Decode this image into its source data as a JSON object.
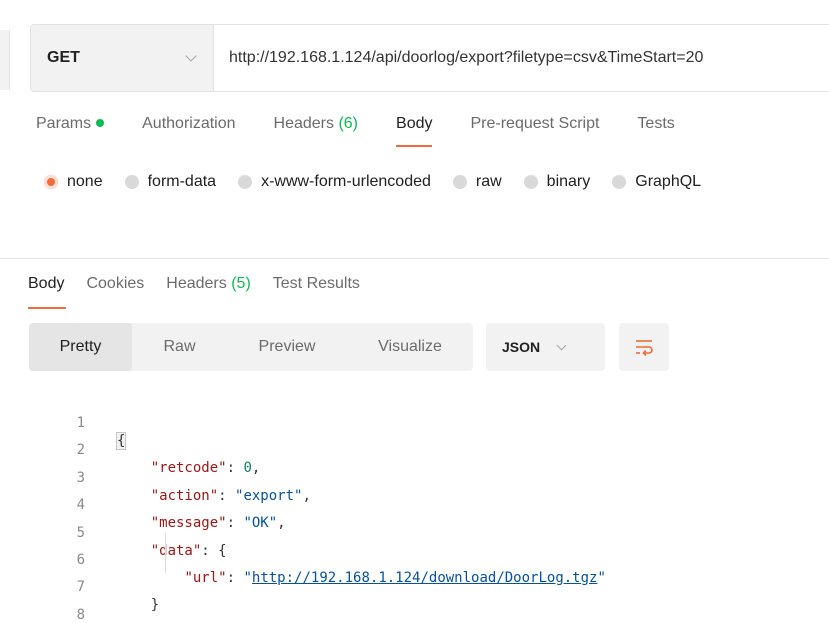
{
  "request": {
    "method": "GET",
    "url": "http://192.168.1.124/api/doorlog/export?filetype=csv&TimeStart=20"
  },
  "request_tabs": {
    "params": "Params",
    "authorization": "Authorization",
    "headers_label": "Headers",
    "headers_count": "(6)",
    "body": "Body",
    "pre_request": "Pre-request Script",
    "tests": "Tests"
  },
  "body_types": {
    "none": "none",
    "form_data": "form-data",
    "urlencoded": "x-www-form-urlencoded",
    "raw": "raw",
    "binary": "binary",
    "graphql": "GraphQL",
    "selected": "none"
  },
  "response_tabs": {
    "body": "Body",
    "cookies": "Cookies",
    "headers_label": "Headers",
    "headers_count": "(5)",
    "test_results": "Test Results"
  },
  "view": {
    "pretty": "Pretty",
    "raw": "Raw",
    "preview": "Preview",
    "visualize": "Visualize",
    "format": "JSON"
  },
  "code": {
    "line_numbers": [
      "1",
      "2",
      "3",
      "4",
      "5",
      "6",
      "7",
      "8"
    ],
    "open_brace": "{",
    "retcode_key": "\"retcode\"",
    "retcode_value": "0",
    "action_key": "\"action\"",
    "action_value": "\"export\"",
    "message_key": "\"message\"",
    "message_value": "\"OK\"",
    "data_key": "\"data\"",
    "url_key": "\"url\"",
    "url_value": "http://192.168.1.124/download/DoorLog.tgz",
    "quote": "\"",
    "inner_close": "}",
    "close_brace": "}"
  },
  "colors": {
    "accent": "#f26b3a",
    "count_green": "#0cbb52",
    "json_key": "#a31515",
    "json_string": "#0451a5",
    "json_number": "#098658"
  }
}
